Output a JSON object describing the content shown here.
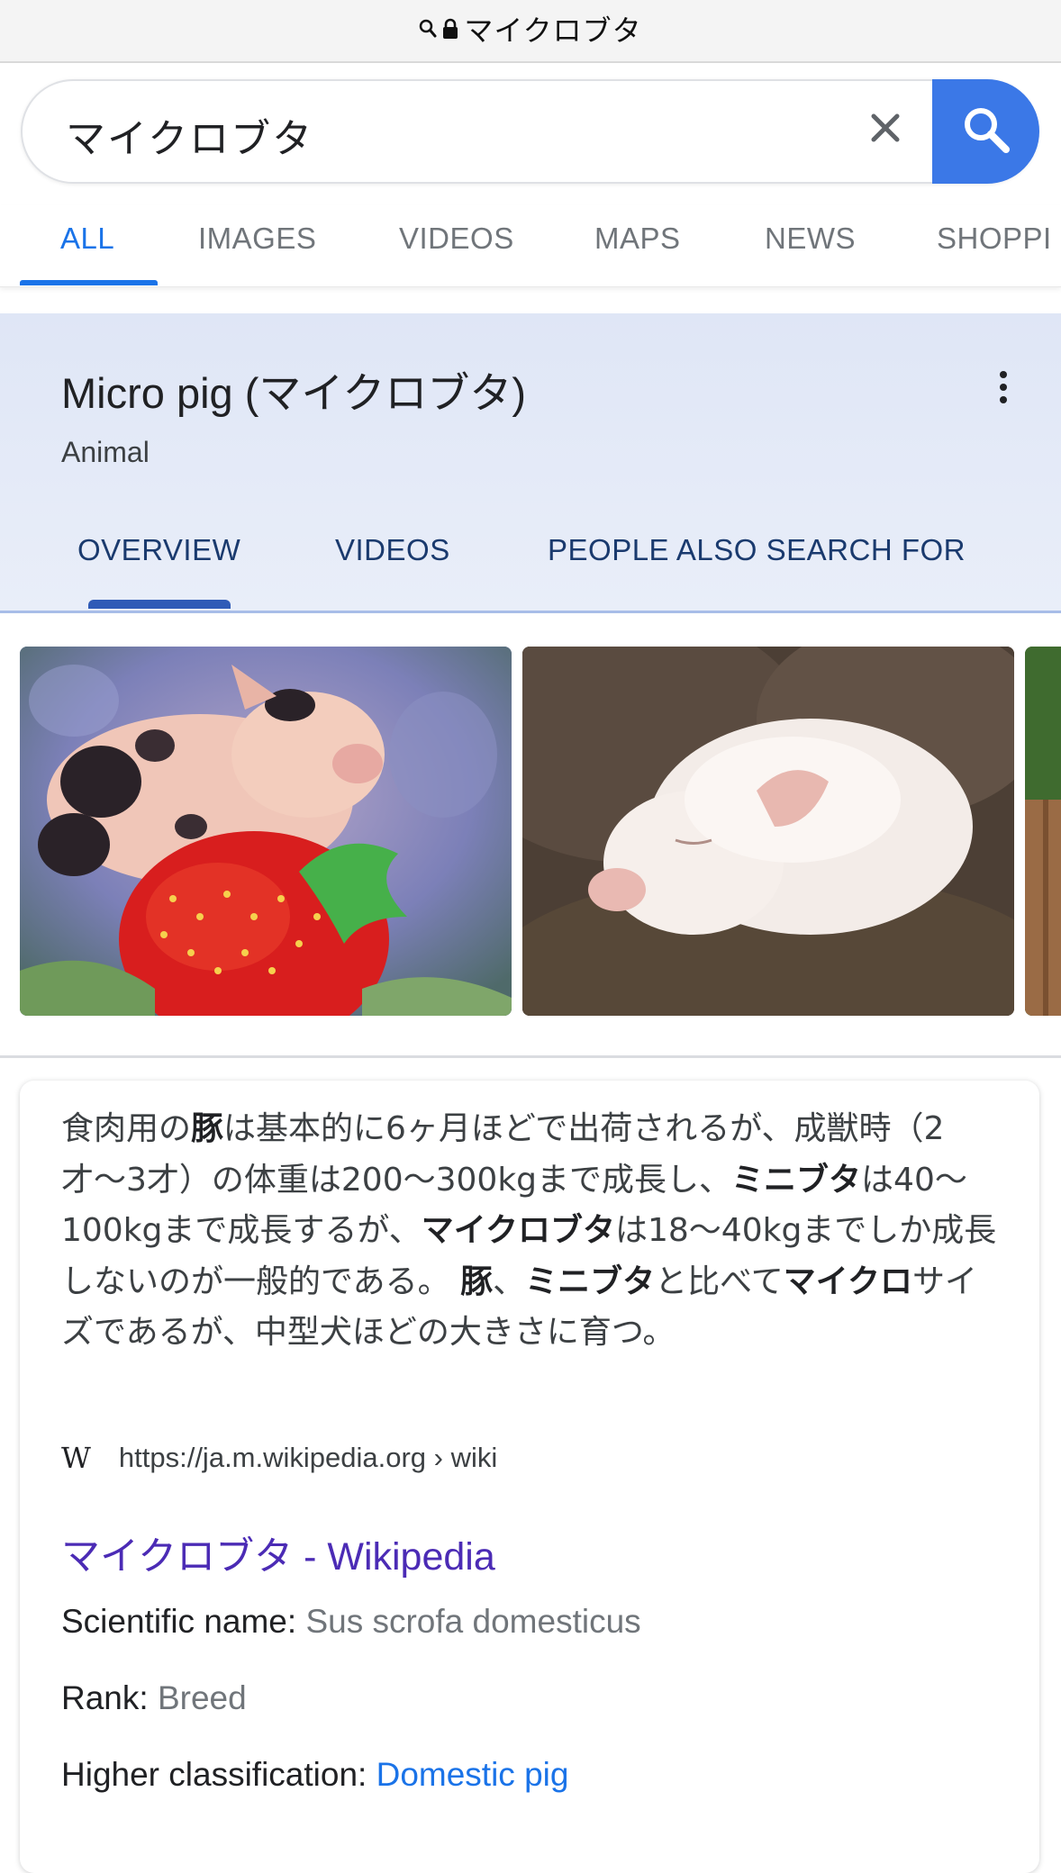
{
  "browser": {
    "address": "マイクロブタ",
    "icons": [
      "search-icon",
      "lock-icon"
    ]
  },
  "search": {
    "query": "マイクロブタ",
    "icons": [
      "close-icon",
      "search-icon"
    ]
  },
  "tabs": [
    "ALL",
    "IMAGES",
    "VIDEOS",
    "MAPS",
    "NEWS",
    "SHOPPI"
  ],
  "active_tab": "ALL",
  "knowledge_panel": {
    "title": "Micro pig (マイクロブタ)",
    "subtitle": "Animal",
    "tabs": [
      "OVERVIEW",
      "VIDEOS",
      "PEOPLE ALSO SEARCH FOR"
    ],
    "active_tab": "OVERVIEW",
    "images": [
      "piglet-on-strawberry-image",
      "sleeping-piglet-image",
      "partial-image"
    ]
  },
  "description": {
    "segments": [
      {
        "t": "食肉用の",
        "b": false
      },
      {
        "t": "豚",
        "b": true
      },
      {
        "t": "は基本的に6ヶ月ほどで出荷されるが、成獣時（2才〜3才）の体重は200〜300kgまで成長し、",
        "b": false
      },
      {
        "t": "ミニブタ",
        "b": true
      },
      {
        "t": "は40〜100kgまで成長するが、",
        "b": false
      },
      {
        "t": "マイクロブタ",
        "b": true
      },
      {
        "t": "は18〜40kgまでしか成長しないのが一般的である。 ",
        "b": false
      },
      {
        "t": "豚",
        "b": true
      },
      {
        "t": "、",
        "b": false
      },
      {
        "t": "ミニブタ",
        "b": true
      },
      {
        "t": "と比べて",
        "b": false
      },
      {
        "t": "マイクロ",
        "b": true
      },
      {
        "t": "サイズであるが、中型犬ほどの大きさに育つ。",
        "b": false
      }
    ],
    "source_logo": "W",
    "source_url": "https://ja.m.wikipedia.org › wiki",
    "link_title": "マイクロブタ - Wikipedia"
  },
  "facts": {
    "scientific_label": "Scientific name:",
    "scientific_value": "Sus scrofa domesticus",
    "rank_label": "Rank:",
    "rank_value": "Breed",
    "higher_label": "Higher classification:",
    "higher_value": "Domestic pig"
  },
  "colors": {
    "accent": "#1a73e8",
    "search_button": "#3b78e7",
    "panel_bg": "#e4eaf7",
    "visited_link": "#4b2bb5"
  }
}
